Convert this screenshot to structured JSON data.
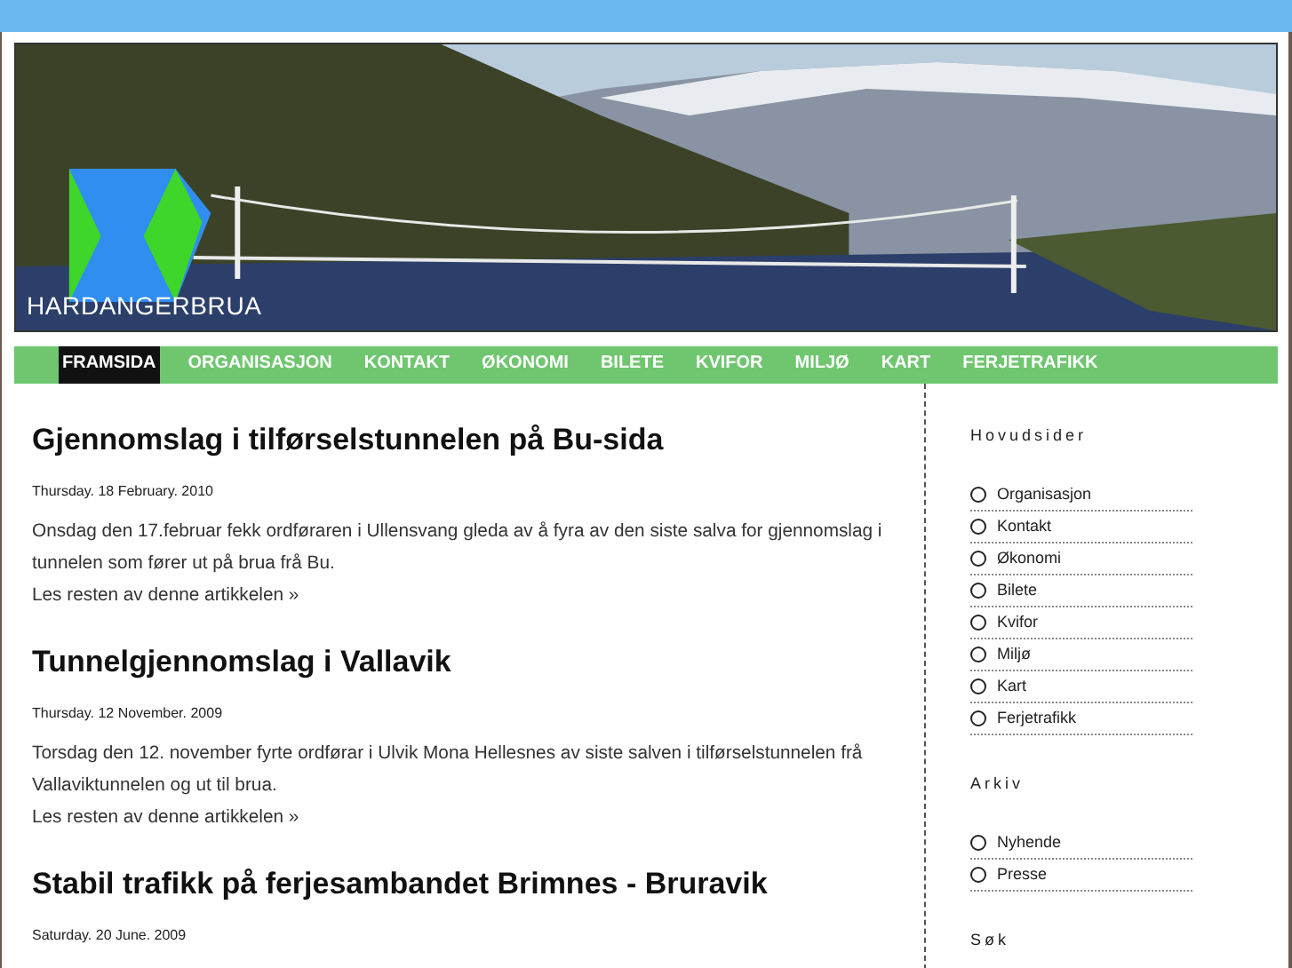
{
  "banner": {
    "logo_text": "HARDANGERBRUA"
  },
  "nav": [
    {
      "label": "FRAMSIDA",
      "selected": true
    },
    {
      "label": "ORGANISASJON",
      "selected": false
    },
    {
      "label": "KONTAKT",
      "selected": false
    },
    {
      "label": "ØKONOMI",
      "selected": false
    },
    {
      "label": "BILETE",
      "selected": false
    },
    {
      "label": "KVIFOR",
      "selected": false
    },
    {
      "label": "MILJØ",
      "selected": false
    },
    {
      "label": "KART",
      "selected": false
    },
    {
      "label": "FERJETRAFIKK",
      "selected": false
    }
  ],
  "articles": [
    {
      "title": "Gjennomslag i tilførselstunnelen på Bu-sida",
      "date": "Thursday. 18 February. 2010",
      "body": "Onsdag den 17.februar fekk ordføraren i Ullensvang gleda av å fyra av den siste salva for gjennomslag i tunnelen som fører ut på brua frå Bu.",
      "more": "Les resten av denne artikkelen »"
    },
    {
      "title": "Tunnelgjennomslag i Vallavik",
      "date": "Thursday. 12 November. 2009",
      "body": "Torsdag den 12. november fyrte ordførar i Ulvik Mona Hellesnes av siste salven i tilførselstunnelen frå Vallaviktunnelen og ut til brua.",
      "more": "Les resten av denne artikkelen »"
    },
    {
      "title": "Stabil trafikk på ferjesambandet Brimnes - Bruravik",
      "date": "Saturday. 20 June. 2009"
    }
  ],
  "sidebar": [
    {
      "heading": "Hovudsider",
      "items": [
        "Organisasjon",
        "Kontakt",
        "Økonomi",
        "Bilete",
        "Kvifor",
        "Miljø",
        "Kart",
        "Ferjetrafikk"
      ]
    },
    {
      "heading": "Arkiv",
      "items": [
        "Nyhende",
        "Presse"
      ]
    },
    {
      "heading": "Søk"
    }
  ]
}
